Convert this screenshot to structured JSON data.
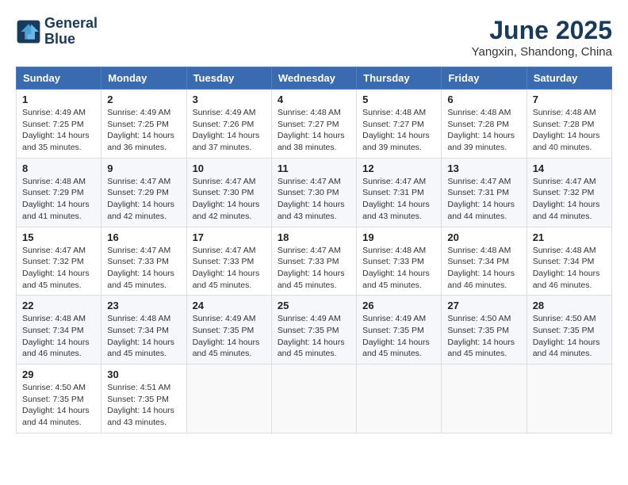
{
  "header": {
    "logo_line1": "General",
    "logo_line2": "Blue",
    "month_title": "June 2025",
    "subtitle": "Yangxin, Shandong, China"
  },
  "days_of_week": [
    "Sunday",
    "Monday",
    "Tuesday",
    "Wednesday",
    "Thursday",
    "Friday",
    "Saturday"
  ],
  "weeks": [
    [
      {
        "day": "1",
        "sunrise": "4:49 AM",
        "sunset": "7:25 PM",
        "daylight": "14 hours and 35 minutes."
      },
      {
        "day": "2",
        "sunrise": "4:49 AM",
        "sunset": "7:25 PM",
        "daylight": "14 hours and 36 minutes."
      },
      {
        "day": "3",
        "sunrise": "4:49 AM",
        "sunset": "7:26 PM",
        "daylight": "14 hours and 37 minutes."
      },
      {
        "day": "4",
        "sunrise": "4:48 AM",
        "sunset": "7:27 PM",
        "daylight": "14 hours and 38 minutes."
      },
      {
        "day": "5",
        "sunrise": "4:48 AM",
        "sunset": "7:27 PM",
        "daylight": "14 hours and 39 minutes."
      },
      {
        "day": "6",
        "sunrise": "4:48 AM",
        "sunset": "7:28 PM",
        "daylight": "14 hours and 39 minutes."
      },
      {
        "day": "7",
        "sunrise": "4:48 AM",
        "sunset": "7:28 PM",
        "daylight": "14 hours and 40 minutes."
      }
    ],
    [
      {
        "day": "8",
        "sunrise": "4:48 AM",
        "sunset": "7:29 PM",
        "daylight": "14 hours and 41 minutes."
      },
      {
        "day": "9",
        "sunrise": "4:47 AM",
        "sunset": "7:29 PM",
        "daylight": "14 hours and 42 minutes."
      },
      {
        "day": "10",
        "sunrise": "4:47 AM",
        "sunset": "7:30 PM",
        "daylight": "14 hours and 42 minutes."
      },
      {
        "day": "11",
        "sunrise": "4:47 AM",
        "sunset": "7:30 PM",
        "daylight": "14 hours and 43 minutes."
      },
      {
        "day": "12",
        "sunrise": "4:47 AM",
        "sunset": "7:31 PM",
        "daylight": "14 hours and 43 minutes."
      },
      {
        "day": "13",
        "sunrise": "4:47 AM",
        "sunset": "7:31 PM",
        "daylight": "14 hours and 44 minutes."
      },
      {
        "day": "14",
        "sunrise": "4:47 AM",
        "sunset": "7:32 PM",
        "daylight": "14 hours and 44 minutes."
      }
    ],
    [
      {
        "day": "15",
        "sunrise": "4:47 AM",
        "sunset": "7:32 PM",
        "daylight": "14 hours and 45 minutes."
      },
      {
        "day": "16",
        "sunrise": "4:47 AM",
        "sunset": "7:33 PM",
        "daylight": "14 hours and 45 minutes."
      },
      {
        "day": "17",
        "sunrise": "4:47 AM",
        "sunset": "7:33 PM",
        "daylight": "14 hours and 45 minutes."
      },
      {
        "day": "18",
        "sunrise": "4:47 AM",
        "sunset": "7:33 PM",
        "daylight": "14 hours and 45 minutes."
      },
      {
        "day": "19",
        "sunrise": "4:48 AM",
        "sunset": "7:33 PM",
        "daylight": "14 hours and 45 minutes."
      },
      {
        "day": "20",
        "sunrise": "4:48 AM",
        "sunset": "7:34 PM",
        "daylight": "14 hours and 46 minutes."
      },
      {
        "day": "21",
        "sunrise": "4:48 AM",
        "sunset": "7:34 PM",
        "daylight": "14 hours and 46 minutes."
      }
    ],
    [
      {
        "day": "22",
        "sunrise": "4:48 AM",
        "sunset": "7:34 PM",
        "daylight": "14 hours and 46 minutes."
      },
      {
        "day": "23",
        "sunrise": "4:48 AM",
        "sunset": "7:34 PM",
        "daylight": "14 hours and 45 minutes."
      },
      {
        "day": "24",
        "sunrise": "4:49 AM",
        "sunset": "7:35 PM",
        "daylight": "14 hours and 45 minutes."
      },
      {
        "day": "25",
        "sunrise": "4:49 AM",
        "sunset": "7:35 PM",
        "daylight": "14 hours and 45 minutes."
      },
      {
        "day": "26",
        "sunrise": "4:49 AM",
        "sunset": "7:35 PM",
        "daylight": "14 hours and 45 minutes."
      },
      {
        "day": "27",
        "sunrise": "4:50 AM",
        "sunset": "7:35 PM",
        "daylight": "14 hours and 45 minutes."
      },
      {
        "day": "28",
        "sunrise": "4:50 AM",
        "sunset": "7:35 PM",
        "daylight": "14 hours and 44 minutes."
      }
    ],
    [
      {
        "day": "29",
        "sunrise": "4:50 AM",
        "sunset": "7:35 PM",
        "daylight": "14 hours and 44 minutes."
      },
      {
        "day": "30",
        "sunrise": "4:51 AM",
        "sunset": "7:35 PM",
        "daylight": "14 hours and 43 minutes."
      },
      null,
      null,
      null,
      null,
      null
    ]
  ]
}
